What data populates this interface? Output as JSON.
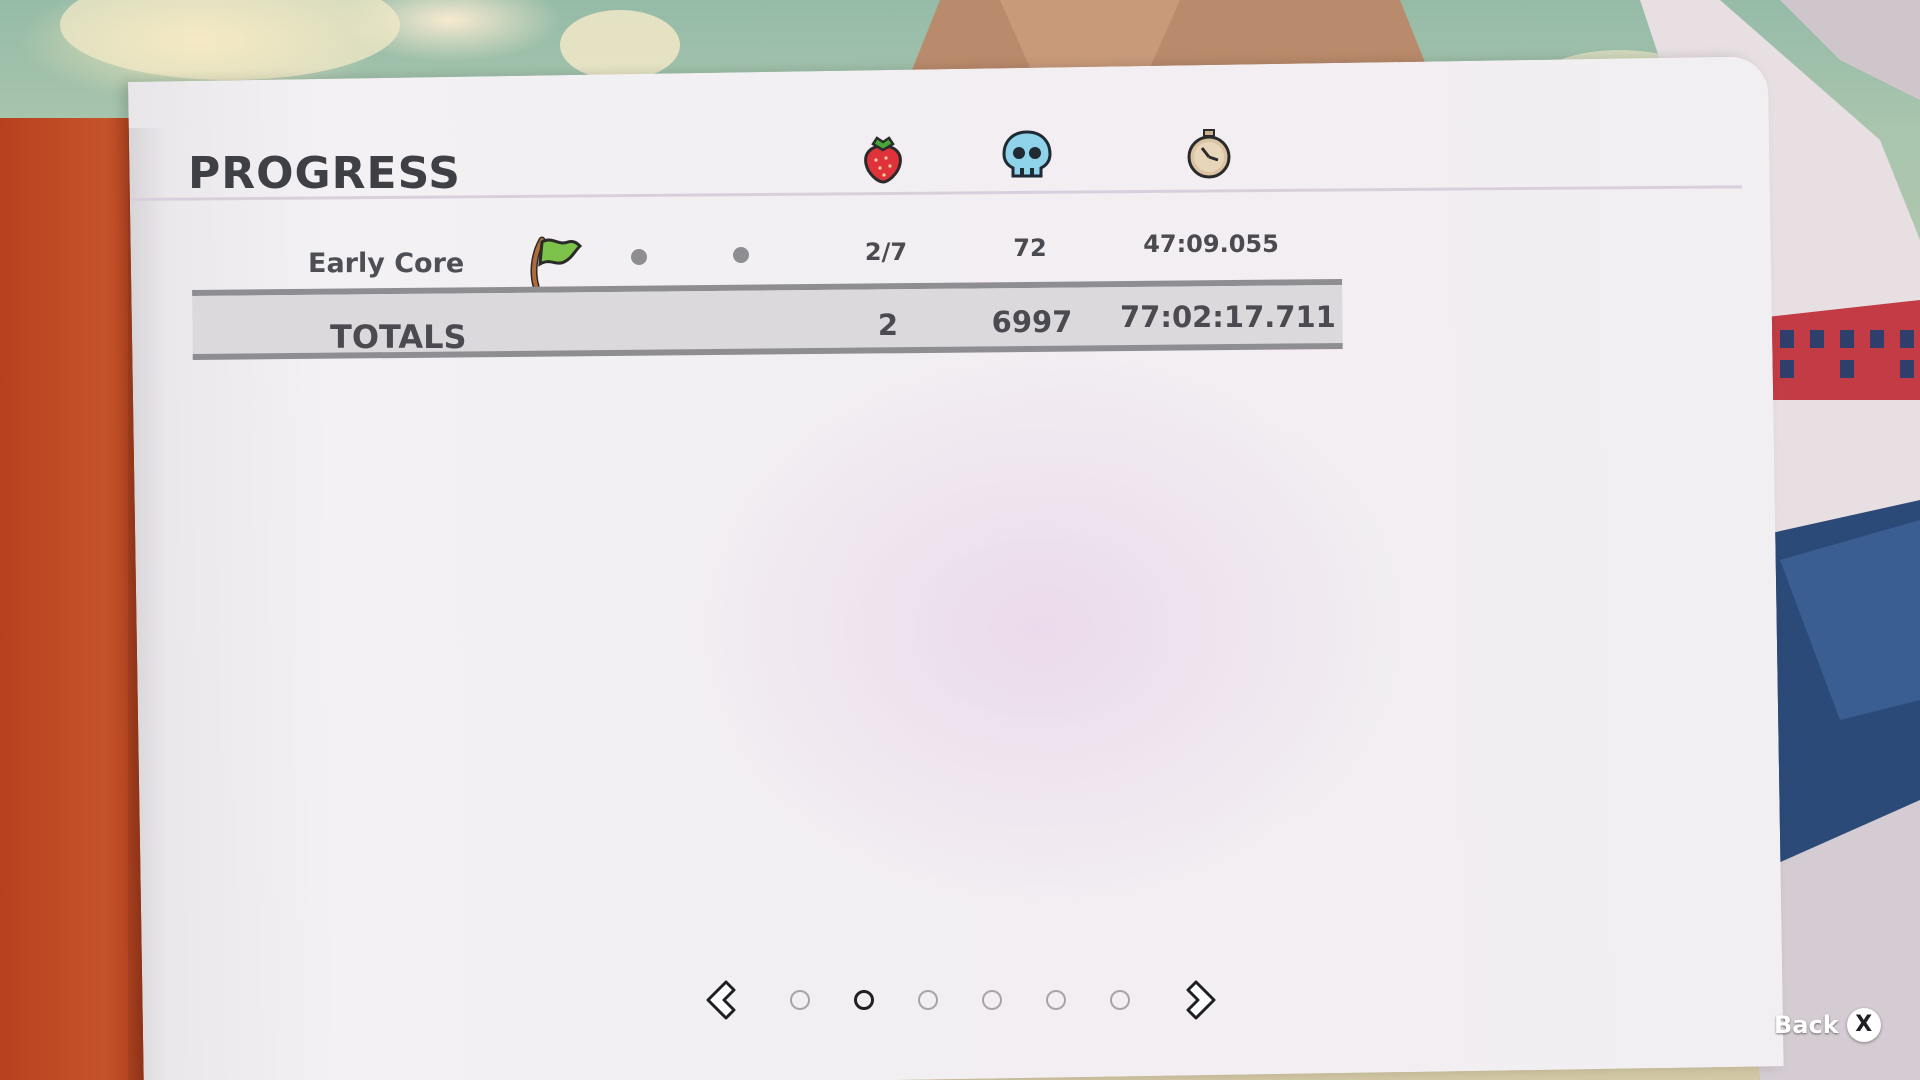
{
  "screen": {
    "title": "PROGRESS"
  },
  "columns": [
    {
      "icon": "strawberry-icon"
    },
    {
      "icon": "skull-icon"
    },
    {
      "icon": "stopwatch-icon"
    }
  ],
  "rows": [
    {
      "chapter": "Early Core",
      "checkpoint_icon": "flag-icon",
      "strawberries": "2/7",
      "deaths": "72",
      "time": "47:09.055"
    }
  ],
  "totals": {
    "label": "TOTALS",
    "strawberries": "2",
    "deaths": "6997",
    "time": "77:02:17.711"
  },
  "pager": {
    "pages": 6,
    "active_index": 1
  },
  "back": {
    "label": "Back",
    "button_glyph": "X"
  },
  "colors": {
    "book_edge": "#c5532a",
    "paper": "#f2eef2",
    "text": "#4a4a50"
  }
}
